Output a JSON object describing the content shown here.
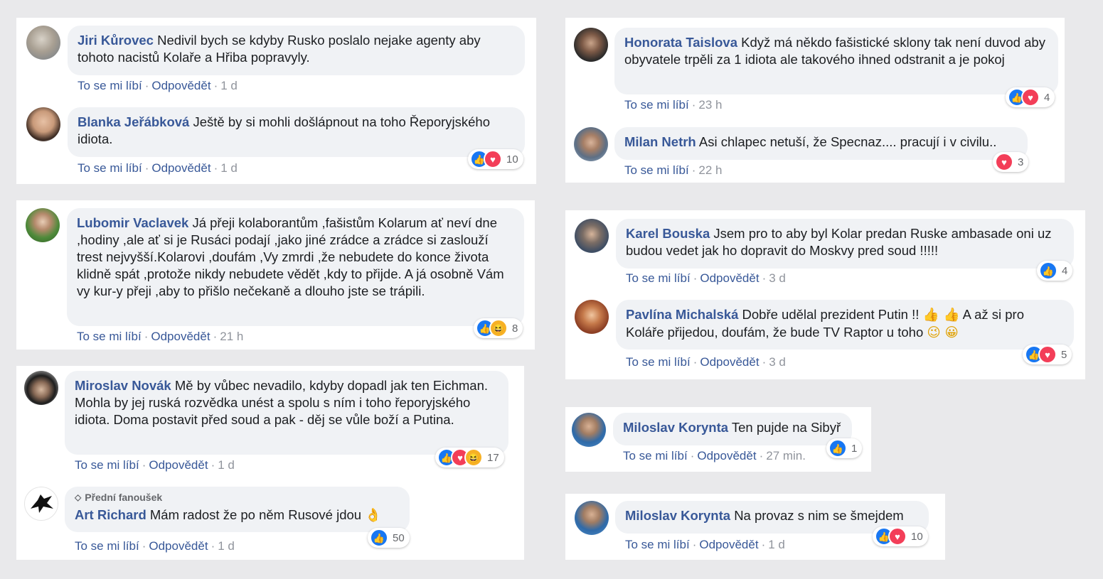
{
  "actions": {
    "like": "To se mi líbí",
    "reply": "Odpovědět",
    "dot": "·"
  },
  "c1": {
    "author": "Jiri Kůrovec",
    "text": "Nedivil bych se kdyby Rusko poslalo nejake agenty aby tohoto nacistů Kolaře a Hřiba popravyly.",
    "time": "1 d"
  },
  "c2": {
    "author": "Blanka Jeřábková",
    "text": "Ještě by si mohli došlápnout na toho Řeporyjského idiota.",
    "time": "1 d",
    "reactions": "10"
  },
  "c3": {
    "author": "Lubomir Vaclavek",
    "text": "Já přeji kolaborantům ,fašistům Kolarum ať neví dne ,hodiny ,ale ať si je Rusáci podají ,jako jiné zrádce a zrádce si zaslouží trest nejvyšší.Kolarovi ,doufám ,Vy zmrdi ,že nebudete do konce života klidně spát ,protože nikdy nebudete vědět ,kdy to přijde. A já osobně Vám vy kur-y přeji ,aby to přišlo nečekaně a dlouho jste se trápili.",
    "time": "21 h",
    "reactions": "8"
  },
  "c4": {
    "author": "Miroslav Novák",
    "text": "Mě by vůbec nevadilo, kdyby dopadl jak ten Eichman. Mohla by jej ruská rozvědka unést a spolu s ním i toho řeporyjského idiota. Doma postavit před soud a pak - děj se vůle boží a Putina.",
    "time": "1 d",
    "reactions": "17"
  },
  "c5": {
    "badge": "Přední fanoušek",
    "author": "Art Richard",
    "text": "Mám radost že po něm Rusové jdou",
    "emoji": "👌",
    "time": "1 d",
    "reactions": "50"
  },
  "c6": {
    "author": "Honorata Taislova",
    "text": "Když má někdo fašistické sklony tak není duvod aby obyvatele trpěli za 1 idiota ale takového ihned odstranit a je pokoj",
    "time": "23 h",
    "reactions": "4"
  },
  "c7": {
    "author": "Milan Netrh",
    "text": "Asi chlapec netuší, že Specnaz.... pracují i v civilu..",
    "time": "22 h",
    "reactions": "3"
  },
  "c8": {
    "author": "Karel Bouska",
    "text": "Jsem pro to aby byl Kolar predan Ruske ambasade oni uz budou vedet jak ho dopravit do Moskvy pred soud !!!!!",
    "time": "3 d",
    "reactions": "4"
  },
  "c9": {
    "author": "Pavlína Michalská",
    "text1": "Dobře udělal prezident Putin !!",
    "emoji1": "👍 👍",
    "text2": "A až si pro Koláře přijedou, doufám, že bude TV Raptor u toho",
    "emoji2": "😉 😀",
    "time": "3 d",
    "reactions": "5"
  },
  "c10": {
    "author": "Miloslav Korynta",
    "text": "Ten pujde na Sibyř",
    "time": "27 min.",
    "reactions": "1"
  },
  "c11": {
    "author": "Miloslav Korynta",
    "text": "Na provaz s nim se šmejdem",
    "time": "1 d",
    "reactions": "10"
  },
  "colors": {
    "author": "#385898",
    "bubble": "#f0f2f5",
    "like": "#1877f2",
    "love": "#f33e58",
    "haha": "#f7b125",
    "background": "#e9e9eb"
  }
}
